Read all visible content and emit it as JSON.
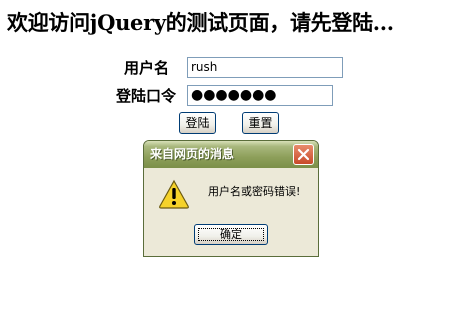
{
  "page": {
    "title": "欢迎访问jQuery的测试页面，请先登陆..."
  },
  "form": {
    "username_label": "用户名",
    "username_value": "rush",
    "password_label": "登陆口令",
    "password_value": "●●●●●●●",
    "login_button": "登陆",
    "reset_button": "重置"
  },
  "dialog": {
    "title": "来自网页的消息",
    "message": "用户名或密码错误!",
    "ok_button": "确定",
    "icon": "warning-icon",
    "close_icon": "close-icon"
  },
  "colors": {
    "titlebar": "#8d9f5a",
    "dialog_bg": "#ece9d8",
    "close_button": "#c84a2a",
    "warning_yellow": "#f5d22a"
  }
}
